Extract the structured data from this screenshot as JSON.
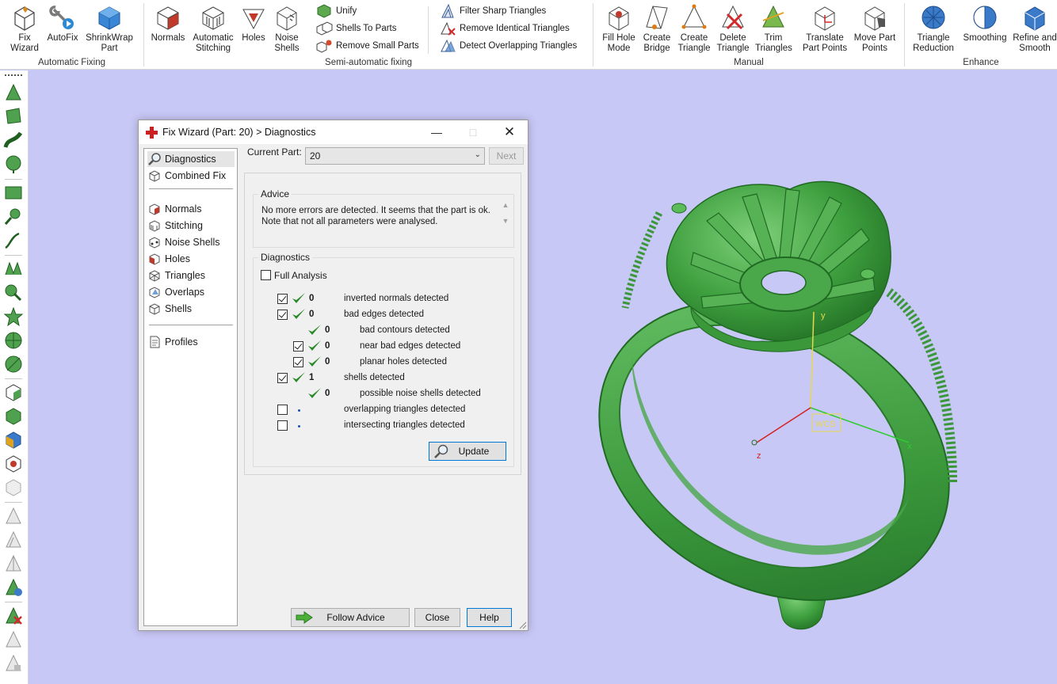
{
  "ribbon": {
    "groups": [
      {
        "label": "Automatic Fixing",
        "buttons": [
          "Fix\nWizard",
          "AutoFix",
          "ShrinkWrap\nPart"
        ]
      },
      {
        "label": "Semi-automatic fixing",
        "buttons": [
          "Normals",
          "Automatic\nStitching",
          "Holes",
          "Noise\nShells"
        ],
        "small_buttons": [
          "Unify",
          "Shells To Parts",
          "Remove Small Parts",
          "Filter Sharp Triangles",
          "Remove Identical Triangles",
          "Detect Overlapping Triangles"
        ]
      },
      {
        "label": "Manual",
        "buttons": [
          "Fill Hole\nMode",
          "Create\nBridge",
          "Create\nTriangle",
          "Delete\nTriangle",
          "Trim\nTriangles",
          "Translate\nPart Points",
          "Move Part\nPoints"
        ]
      },
      {
        "label": "Enhance",
        "buttons": [
          "Triangle\nReduction",
          "Smoothing",
          "Refine and\nSmooth"
        ]
      }
    ]
  },
  "dialog": {
    "title": "Fix Wizard (Part: 20) > Diagnostics",
    "nav": [
      "Diagnostics",
      "Combined Fix",
      "Normals",
      "Stitching",
      "Noise Shells",
      "Holes",
      "Triangles",
      "Overlaps",
      "Shells",
      "Profiles"
    ],
    "current_part_label": "Current Part:",
    "current_part_value": "20",
    "next_label": "Next",
    "advice_legend": "Advice",
    "advice_text": "No more errors are detected. It seems that the part is ok.\nNote that not all parameters were analysed.",
    "diagnostics_legend": "Diagnostics",
    "full_analysis_label": "Full Analysis",
    "rows": [
      {
        "count": "0",
        "text": "inverted normals detected",
        "checked": true,
        "status": "ok"
      },
      {
        "count": "0",
        "text": "bad edges detected",
        "checked": true,
        "status": "ok"
      },
      {
        "count": "0",
        "text": "bad contours detected",
        "checked": null,
        "status": "ok"
      },
      {
        "count": "0",
        "text": "near bad edges detected",
        "checked": true,
        "status": "ok"
      },
      {
        "count": "0",
        "text": "planar holes detected",
        "checked": true,
        "status": "ok"
      },
      {
        "count": "1",
        "text": "shells detected",
        "checked": true,
        "status": "ok"
      },
      {
        "count": "0",
        "text": "possible noise shells detected",
        "checked": null,
        "status": "ok"
      },
      {
        "count": "",
        "text": "overlapping triangles detected",
        "checked": false,
        "status": "none"
      },
      {
        "count": "",
        "text": "intersecting triangles detected",
        "checked": false,
        "status": "none"
      }
    ],
    "update_label": "Update",
    "follow_advice_label": "Follow Advice",
    "close_label": "Close",
    "help_label": "Help"
  },
  "viewport": {
    "axis_labels": {
      "x": "x",
      "y": "y",
      "z": "z",
      "wcs": "WCS"
    }
  },
  "colors": {
    "viewport_bg": "#c8c8f6",
    "model_green": "#3fa33f",
    "check_green": "#2a8a2a",
    "axis_x": "#2ecc2e",
    "axis_y": "#e8d84a",
    "axis_z": "#d42020"
  }
}
